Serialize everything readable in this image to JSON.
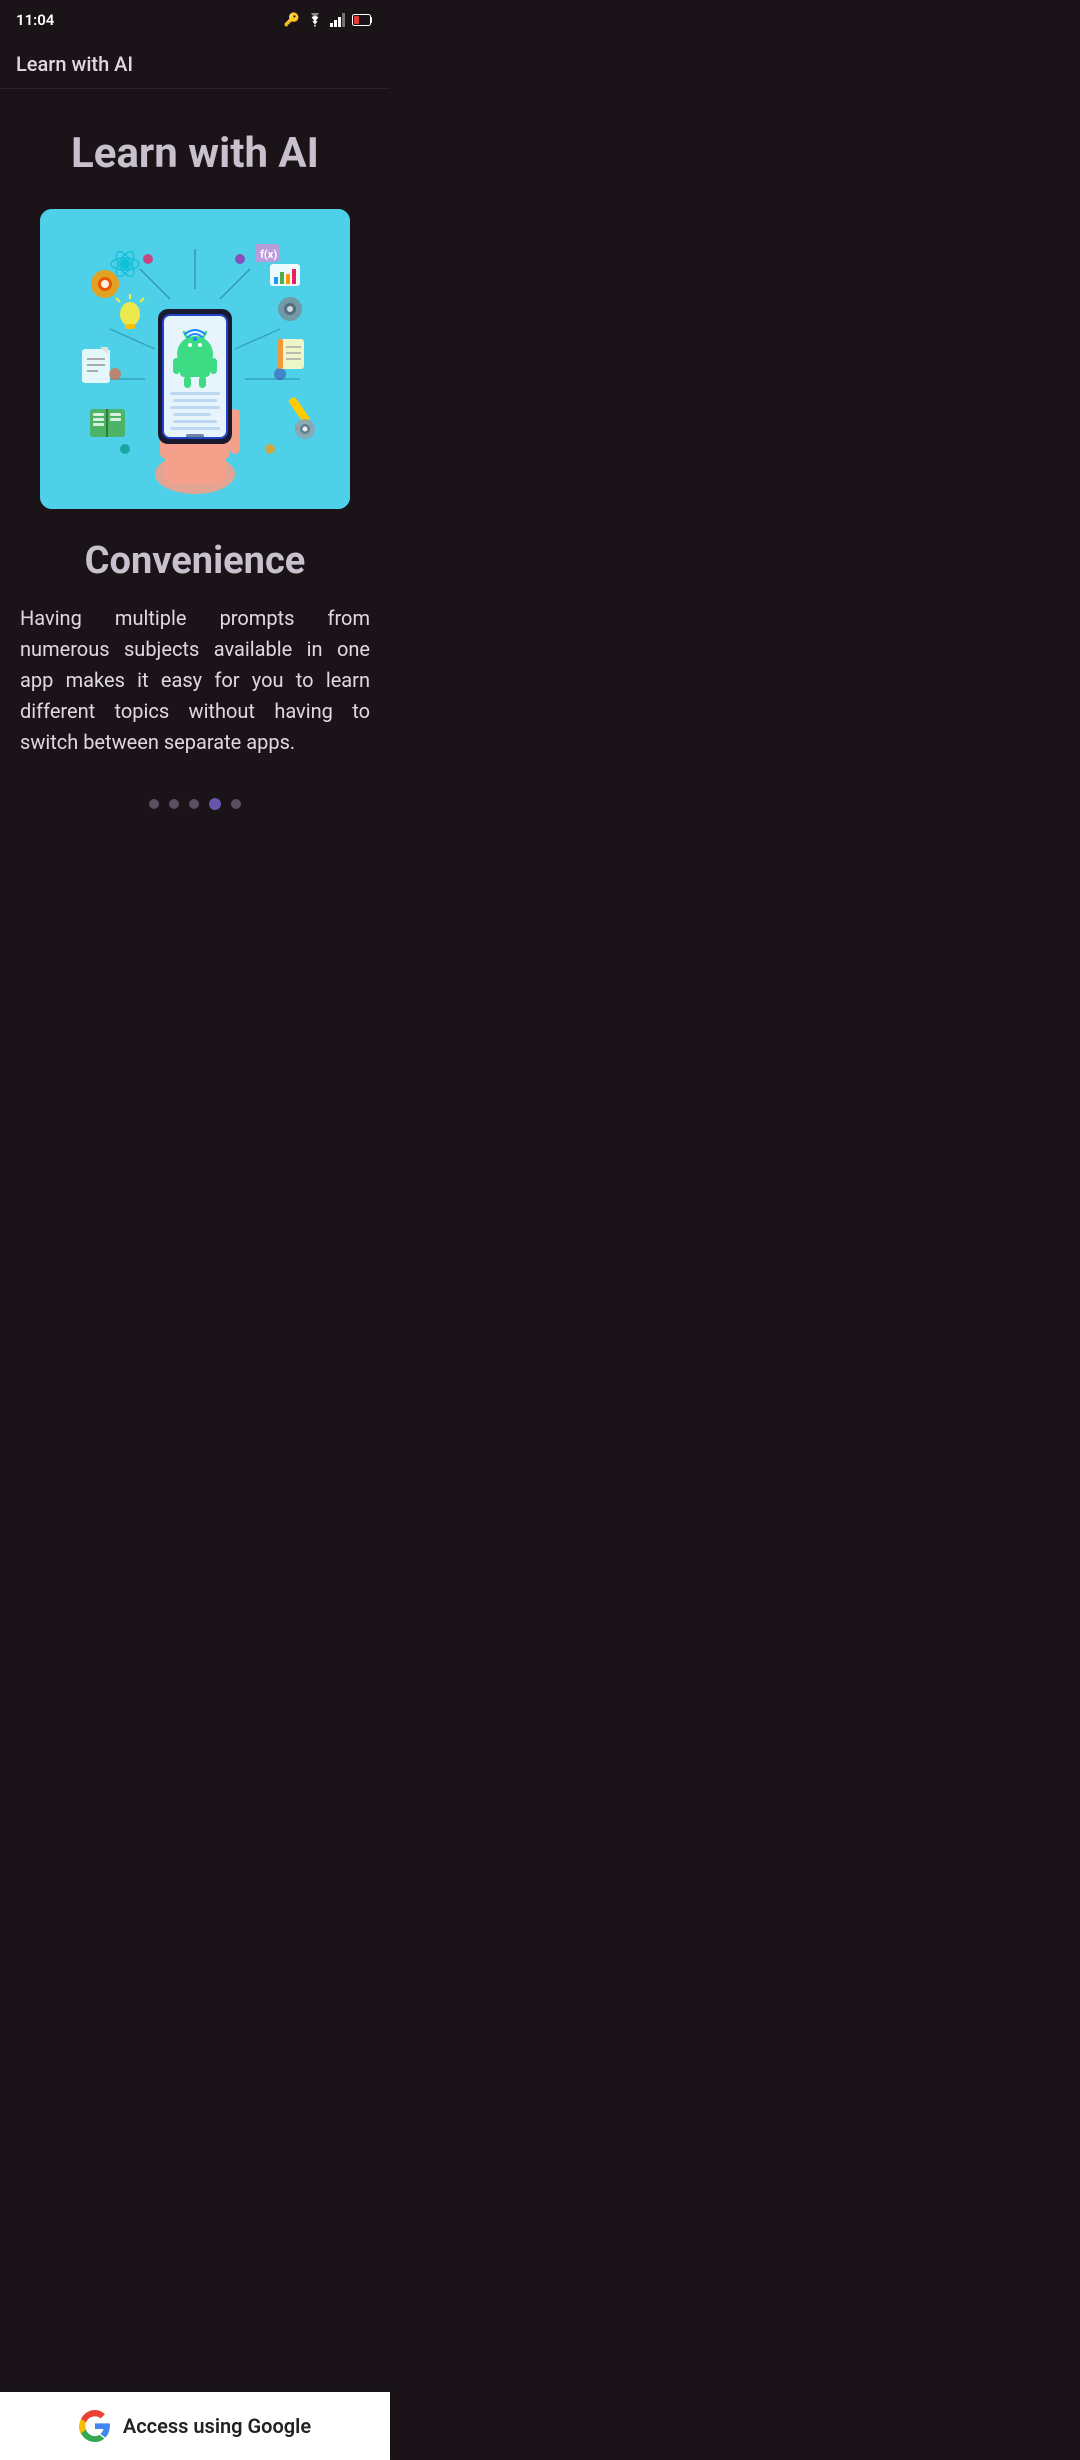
{
  "status_bar": {
    "time": "11:04",
    "wifi_icon": "wifi",
    "signal_icon": "signal",
    "battery_icon": "battery-low"
  },
  "app_bar": {
    "title": "Learn with AI"
  },
  "hero": {
    "title": "Learn with AI"
  },
  "illustration": {
    "alt": "Android phone with AI learning icons"
  },
  "section": {
    "title": "Convenience",
    "description": "Having multiple prompts from numerous subjects available in one app makes it easy for you to learn different topics without having to switch between separate apps."
  },
  "dots": {
    "total": 5,
    "active_index": 3
  },
  "button": {
    "label": "Access using Google"
  }
}
